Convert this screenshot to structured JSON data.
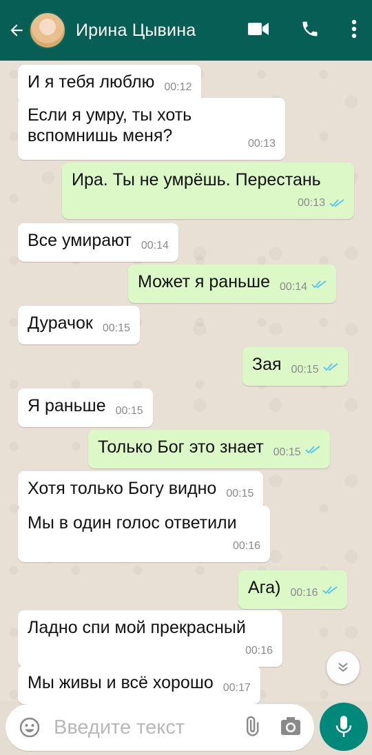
{
  "header": {
    "contact_name": "Ирина Цывина"
  },
  "messages": [
    {
      "text": "И я тебя люблю",
      "time": "00:12",
      "direction": "in"
    },
    {
      "text": "Если я умру, ты хоть вспомнишь меня?",
      "time": "00:13",
      "direction": "in"
    },
    {
      "text": "Ира. Ты не умрёшь. Перестань",
      "time": "00:13",
      "direction": "out"
    },
    {
      "text": "Все умирают",
      "time": "00:14",
      "direction": "in"
    },
    {
      "text": "Может я раньше",
      "time": "00:14",
      "direction": "out"
    },
    {
      "text": "Дурачок",
      "time": "00:15",
      "direction": "in"
    },
    {
      "text": "Зая",
      "time": "00:15",
      "direction": "out"
    },
    {
      "text": "Я раньше",
      "time": "00:15",
      "direction": "in"
    },
    {
      "text": "Только Бог это знает",
      "time": "00:15",
      "direction": "out"
    },
    {
      "text": "Хотя только Богу видно",
      "time": "00:15",
      "direction": "in"
    },
    {
      "text": "Мы в один голос ответили",
      "time": "00:16",
      "direction": "in"
    },
    {
      "text": "Ага)",
      "time": "00:16",
      "direction": "out"
    },
    {
      "text": "Ладно спи мой прекрасный",
      "time": "00:16",
      "direction": "in"
    },
    {
      "text": "Мы живы и всё хорошо",
      "time": "00:17",
      "direction": "in"
    }
  ],
  "composer": {
    "placeholder": "Введите текст"
  },
  "icons": {
    "back": "arrow-left-icon",
    "video": "video-camera-icon",
    "call": "phone-icon",
    "menu": "more-vertical-icon",
    "emoji": "emoji-icon",
    "attach": "paperclip-icon",
    "camera": "camera-icon",
    "mic": "microphone-icon",
    "scroll": "chevrons-down-icon",
    "read": "double-check-icon"
  },
  "colors": {
    "header": "#075e54",
    "outgoing_bubble": "#dcf8c6",
    "incoming_bubble": "#ffffff",
    "read_check": "#4fc3f7",
    "mic_button": "#00897b"
  }
}
